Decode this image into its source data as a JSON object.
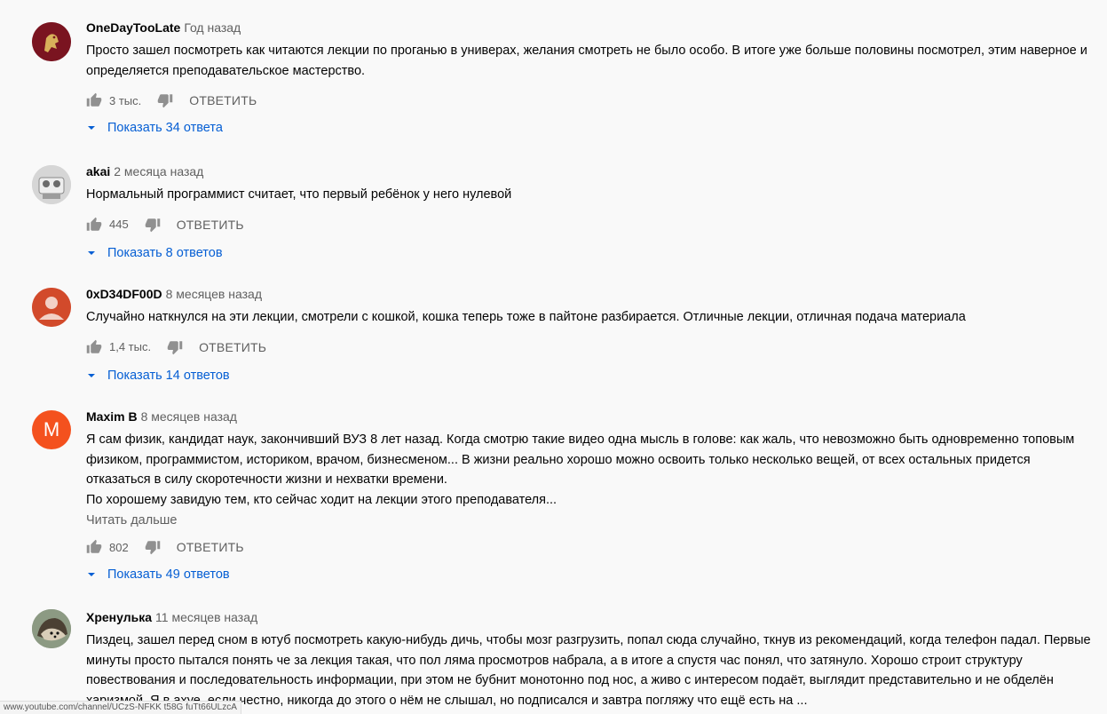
{
  "comments": [
    {
      "author": "OneDayTooLate",
      "time": "Год назад",
      "text": [
        "Просто зашел посмотреть как читаются лекции по проганью в универах, желания смотреть не было особо. В итоге уже больше половины посмотрел, этим наверное и определяется преподавательское мастерство."
      ],
      "likes": "3 тыс.",
      "reply_label": "ОТВЕТИТЬ",
      "replies_label": "Показать 34 ответа",
      "avatar": {
        "kind": "emblem",
        "bg": "#7a1420"
      }
    },
    {
      "author": "akai",
      "time": "2 месяца назад",
      "text": [
        "Нормальный программист считает, что первый ребёнок у него нулевой"
      ],
      "likes": "445",
      "reply_label": "ОТВЕТИТЬ",
      "replies_label": "Показать 8 ответов",
      "avatar": {
        "kind": "photo",
        "bg": "#c9c9c9"
      }
    },
    {
      "author": "0xD34DF00D",
      "time": "8 месяцев назад",
      "text": [
        "Случайно наткнулся на эти лекции, смотрели с кошкой, кошка теперь тоже в пайтоне разбирается. Отличные лекции, отличная подача материала"
      ],
      "likes": "1,4 тыс.",
      "reply_label": "ОТВЕТИТЬ",
      "replies_label": "Показать 14 ответов",
      "avatar": {
        "kind": "person",
        "bg": "#d24a2b"
      }
    },
    {
      "author": "Maxim B",
      "time": "8 месяцев назад",
      "text": [
        "Я сам физик, кандидат наук, закончивший ВУЗ 8 лет назад. Когда смотрю такие видео одна мысль в голове: как жаль, что невозможно быть одновременно топовым физиком, программистом, историком, врачом, бизнесменом... В жизни реально хорошо можно освоить только несколько вещей, от всех остальных придется отказаться в силу скоротечности жизни и нехватки времени.",
        "По хорошему завидую тем, кто сейчас ходит на лекции этого преподавателя..."
      ],
      "read_more": "Читать дальше",
      "likes": "802",
      "reply_label": "ОТВЕТИТЬ",
      "replies_label": "Показать 49 ответов",
      "avatar": {
        "kind": "letter",
        "letter": "M",
        "bg": "#f4511e"
      }
    },
    {
      "author": "Хренулька",
      "time": "11 месяцев назад",
      "text": [
        "Пиздец, зашел перед сном в ютуб посмотреть какую-нибудь дичь, чтобы мозг разгрузить, попал сюда случайно, ткнув из рекомендаций, когда телефон падал. Первые минуты просто пытался понять че за лекция такая, что пол ляма просмотров набрала, а в итоге а спустя час понял, что затянуло. Хорошо строит структуру повествования и последовательность информации, при этом не бубнит монотонно под нос, а живо с интересом подаёт, выглядит представительно и не обделён харизмой. Я в ахуе, если честно, никогда до этого о нём не слышал, но подписался и завтра погляжу что ещё есть на ..."
      ],
      "avatar": {
        "kind": "hedgehog",
        "bg": "#7d8a74"
      }
    }
  ],
  "status_url": "www.youtube.com/channel/UCzS-NFKK t58G fuTt66ULzcA"
}
